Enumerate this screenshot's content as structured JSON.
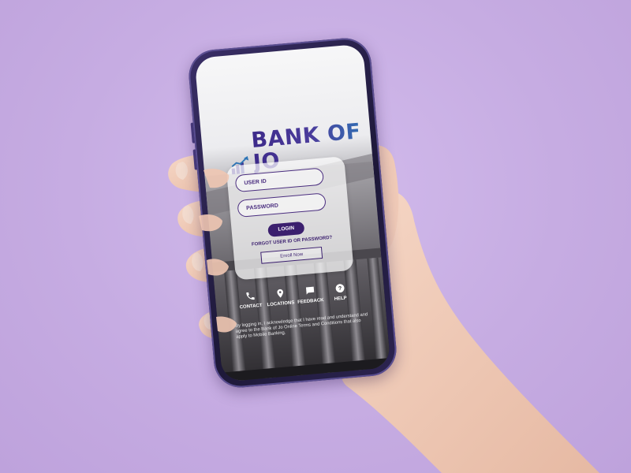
{
  "app": {
    "logo_text": "BANK OF JO"
  },
  "login": {
    "user_id_placeholder": "USER ID",
    "password_placeholder": "PASSWORD",
    "login_label": "LOGIN",
    "forgot_label": "FORGOT USER ID OR PASSWORD?",
    "enroll_label": "Enroll Now"
  },
  "quick_links": [
    {
      "label": "CONTACT",
      "icon": "phone-icon"
    },
    {
      "label": "LOCATIONS",
      "icon": "location-pin-icon"
    },
    {
      "label": "FEEDBACK",
      "icon": "chat-bubble-icon"
    },
    {
      "label": "HELP",
      "icon": "help-icon"
    }
  ],
  "disclaimer": "By logging in, I acknowledge that I have read and understand and agree to the Bank of Jo Online Terms and Conditions that also apply to Mobile Banking.",
  "colors": {
    "background": "#c9b0e4",
    "brand_primary": "#3b1f6e",
    "logo_gradient_start": "#3d2a8a",
    "logo_gradient_end": "#2e75b6"
  }
}
